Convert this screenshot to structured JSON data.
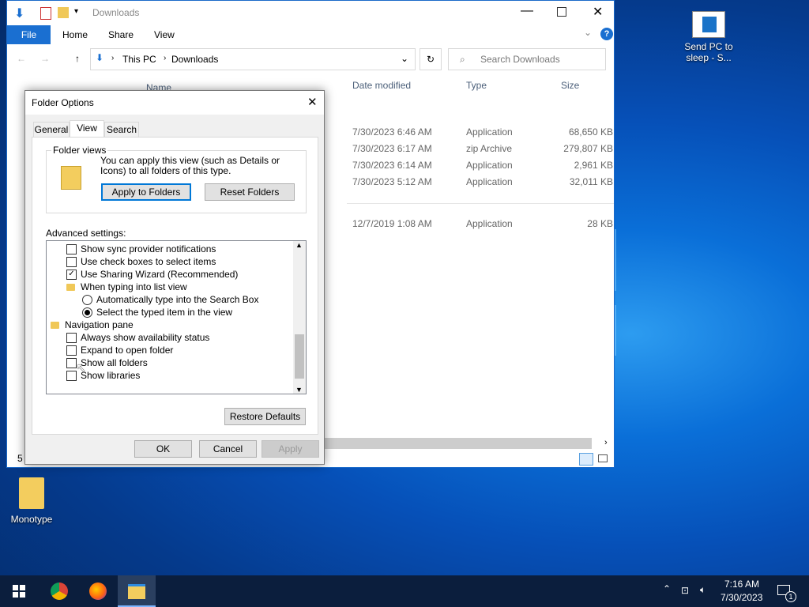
{
  "desktop": {
    "icons": [
      {
        "label": "Send PC to sleep - S..."
      },
      {
        "label": "Monotype"
      }
    ]
  },
  "explorer": {
    "title": "Downloads",
    "ribbon_tabs": [
      "File",
      "Home",
      "Share",
      "View"
    ],
    "breadcrumb": [
      "This PC",
      "Downloads"
    ],
    "search_placeholder": "Search Downloads",
    "columns": [
      "Name",
      "Date modified",
      "Type",
      "Size"
    ],
    "rows": [
      {
        "date": "7/30/2023 6:46 AM",
        "type": "Application",
        "size": "68,650 KB"
      },
      {
        "date": "7/30/2023 6:17 AM",
        "type": "zip Archive",
        "size": "279,807 KB"
      },
      {
        "date": "7/30/2023 6:14 AM",
        "type": "Application",
        "size": "2,961 KB"
      },
      {
        "date": "7/30/2023 5:12 AM",
        "type": "Application",
        "size": "32,011 KB"
      },
      {
        "date": "12/7/2019 1:08 AM",
        "type": "Application",
        "size": "28 KB"
      }
    ],
    "status_count": "5"
  },
  "dialog": {
    "title": "Folder Options",
    "tabs": [
      "General",
      "View",
      "Search"
    ],
    "folder_views_label": "Folder views",
    "folder_views_text": "You can apply this view (such as Details or Icons) to all folders of this type.",
    "apply_folders": "Apply to Folders",
    "reset_folders": "Reset Folders",
    "advanced_label": "Advanced settings:",
    "items": [
      {
        "kind": "checkbox",
        "label": "Show sync provider notifications",
        "checked": false,
        "indent": 1
      },
      {
        "kind": "checkbox",
        "label": "Use check boxes to select items",
        "checked": false,
        "indent": 1
      },
      {
        "kind": "checkbox",
        "label": "Use Sharing Wizard (Recommended)",
        "checked": true,
        "indent": 1
      },
      {
        "kind": "folder",
        "label": "When typing into list view",
        "indent": 1
      },
      {
        "kind": "radio",
        "label": "Automatically type into the Search Box",
        "checked": false,
        "indent": 2
      },
      {
        "kind": "radio",
        "label": "Select the typed item in the view",
        "checked": true,
        "indent": 2
      },
      {
        "kind": "folder",
        "label": "Navigation pane",
        "indent": 0
      },
      {
        "kind": "checkbox",
        "label": "Always show availability status",
        "checked": false,
        "indent": 1
      },
      {
        "kind": "checkbox",
        "label": "Expand to open folder",
        "checked": false,
        "indent": 1
      },
      {
        "kind": "checkbox",
        "label": "Show all folders",
        "checked": false,
        "indent": 1
      },
      {
        "kind": "checkbox",
        "label": "Show libraries",
        "checked": false,
        "indent": 1
      }
    ],
    "restore_defaults": "Restore Defaults",
    "ok": "OK",
    "cancel": "Cancel",
    "apply": "Apply"
  },
  "taskbar": {
    "time": "7:16 AM",
    "date": "7/30/2023",
    "notification_count": "1"
  }
}
